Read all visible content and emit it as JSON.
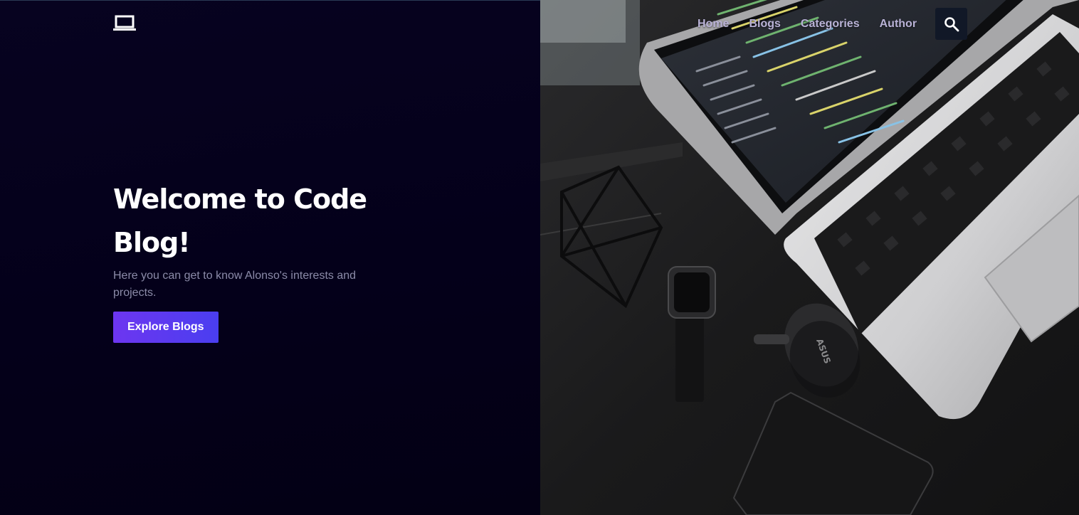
{
  "header": {
    "logo_icon": "laptop-icon",
    "nav": [
      {
        "label": "Home"
      },
      {
        "label": "Blogs"
      },
      {
        "label": "Categories"
      },
      {
        "label": "Author"
      }
    ],
    "search_icon": "search-icon"
  },
  "hero": {
    "title": "Welcome to Code Blog!",
    "subtitle": "Here you can get to know Alonso's interests and projects.",
    "button_label": "Explore Blogs"
  },
  "colors": {
    "background": "#04001a",
    "accent": "#6d36f0",
    "nav_text": "#b9b2d6",
    "subtitle_text": "#8b8ba8"
  },
  "image": {
    "description_icon": "laptop-desk-photo",
    "mouse_brand": "ASUS"
  }
}
